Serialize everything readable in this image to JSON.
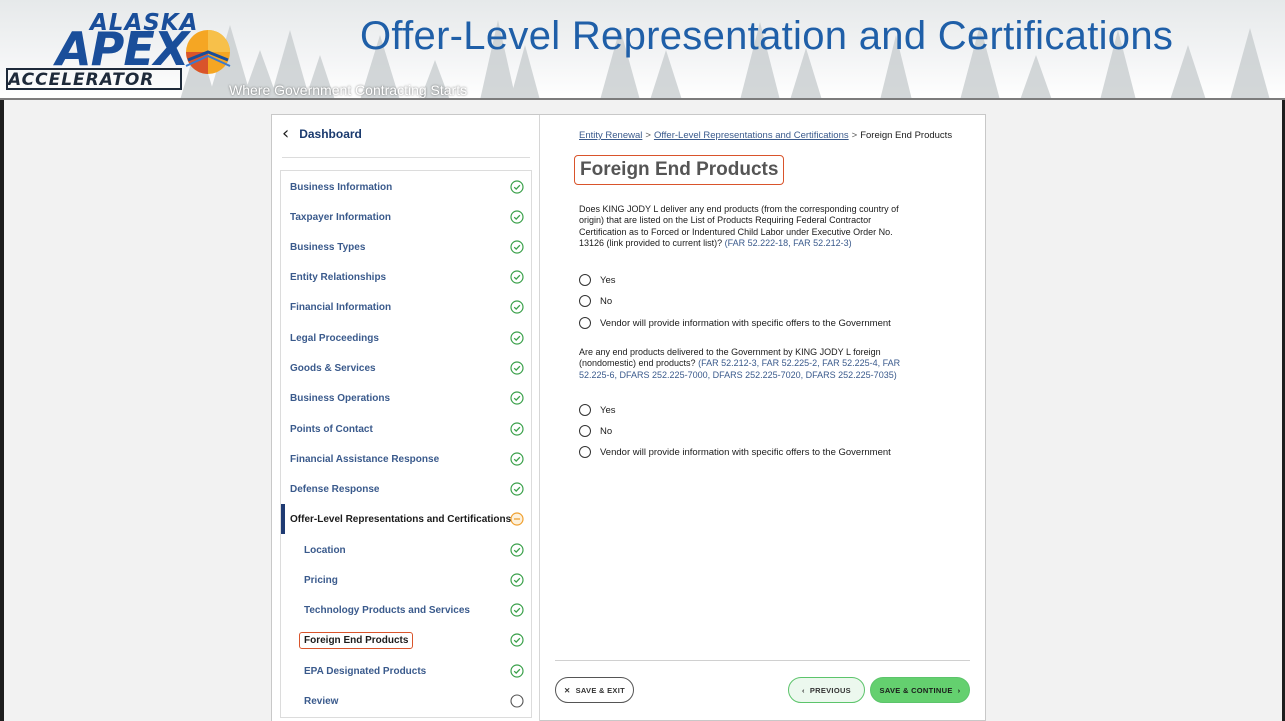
{
  "slide": {
    "title": "Offer-Level Representation and Certifications",
    "tagline": "Where Government Contracting Starts",
    "logo": {
      "line1": "ALASKA",
      "line2": "APEX",
      "line3": "ACCELERATOR"
    }
  },
  "colors": {
    "title_blue": "#1f5fa8",
    "link_blue": "#3a5a8c",
    "highlight_orange": "#d9542b",
    "success_green": "#5cc46b",
    "in_progress_orange": "#f0a030"
  },
  "sidebar": {
    "back_label": "Dashboard",
    "items": [
      {
        "label": "Business Information",
        "status": "complete"
      },
      {
        "label": "Taxpayer Information",
        "status": "complete"
      },
      {
        "label": "Business Types",
        "status": "complete"
      },
      {
        "label": "Entity Relationships",
        "status": "complete"
      },
      {
        "label": "Financial Information",
        "status": "complete"
      },
      {
        "label": "Legal Proceedings",
        "status": "complete"
      },
      {
        "label": "Goods & Services",
        "status": "complete"
      },
      {
        "label": "Business Operations",
        "status": "complete"
      },
      {
        "label": "Points of Contact",
        "status": "complete"
      },
      {
        "label": "Financial Assistance Response",
        "status": "complete"
      },
      {
        "label": "Defense Response",
        "status": "complete"
      },
      {
        "label": "Offer-Level Representations and Certifications",
        "status": "in-progress"
      },
      {
        "label": "Location",
        "status": "complete"
      },
      {
        "label": "Pricing",
        "status": "complete"
      },
      {
        "label": "Technology Products and Services",
        "status": "complete"
      },
      {
        "label": "Foreign End Products",
        "status": "complete"
      },
      {
        "label": "EPA Designated Products",
        "status": "complete"
      },
      {
        "label": "Review",
        "status": "incomplete"
      }
    ]
  },
  "breadcrumb": {
    "link1": "Entity Renewal",
    "separator": ">",
    "link2": "Offer-Level Representations and Certifications",
    "current": "Foreign End Products"
  },
  "main": {
    "heading": "Foreign End Products",
    "q1": {
      "text": "Does KING JODY L deliver any end products (from the corresponding country of origin) that are listed on the List of Products Requiring Federal Contractor Certification as to Forced or Indentured Child Labor under Executive Order No. 13126 (link provided to current list)? ",
      "refs": "(FAR 52.222-18, FAR 52.212-3)",
      "options": [
        "Yes",
        "No",
        "Vendor will provide information with specific offers to the Government"
      ]
    },
    "q2": {
      "text": "Are any end products delivered to the Government by KING JODY L foreign (nondomestic) end products? ",
      "refs": "(FAR 52.212-3, FAR 52.225-2, FAR 52.225-4, FAR 52.225-6, DFARS 252.225-7000, DFARS 252.225-7020, DFARS 252.225-7035)",
      "options": [
        "Yes",
        "No",
        "Vendor will provide information with specific offers to the Government"
      ]
    }
  },
  "footer": {
    "save_exit": "SAVE & EXIT",
    "previous": "PREVIOUS",
    "save_continue": "SAVE & CONTINUE"
  }
}
